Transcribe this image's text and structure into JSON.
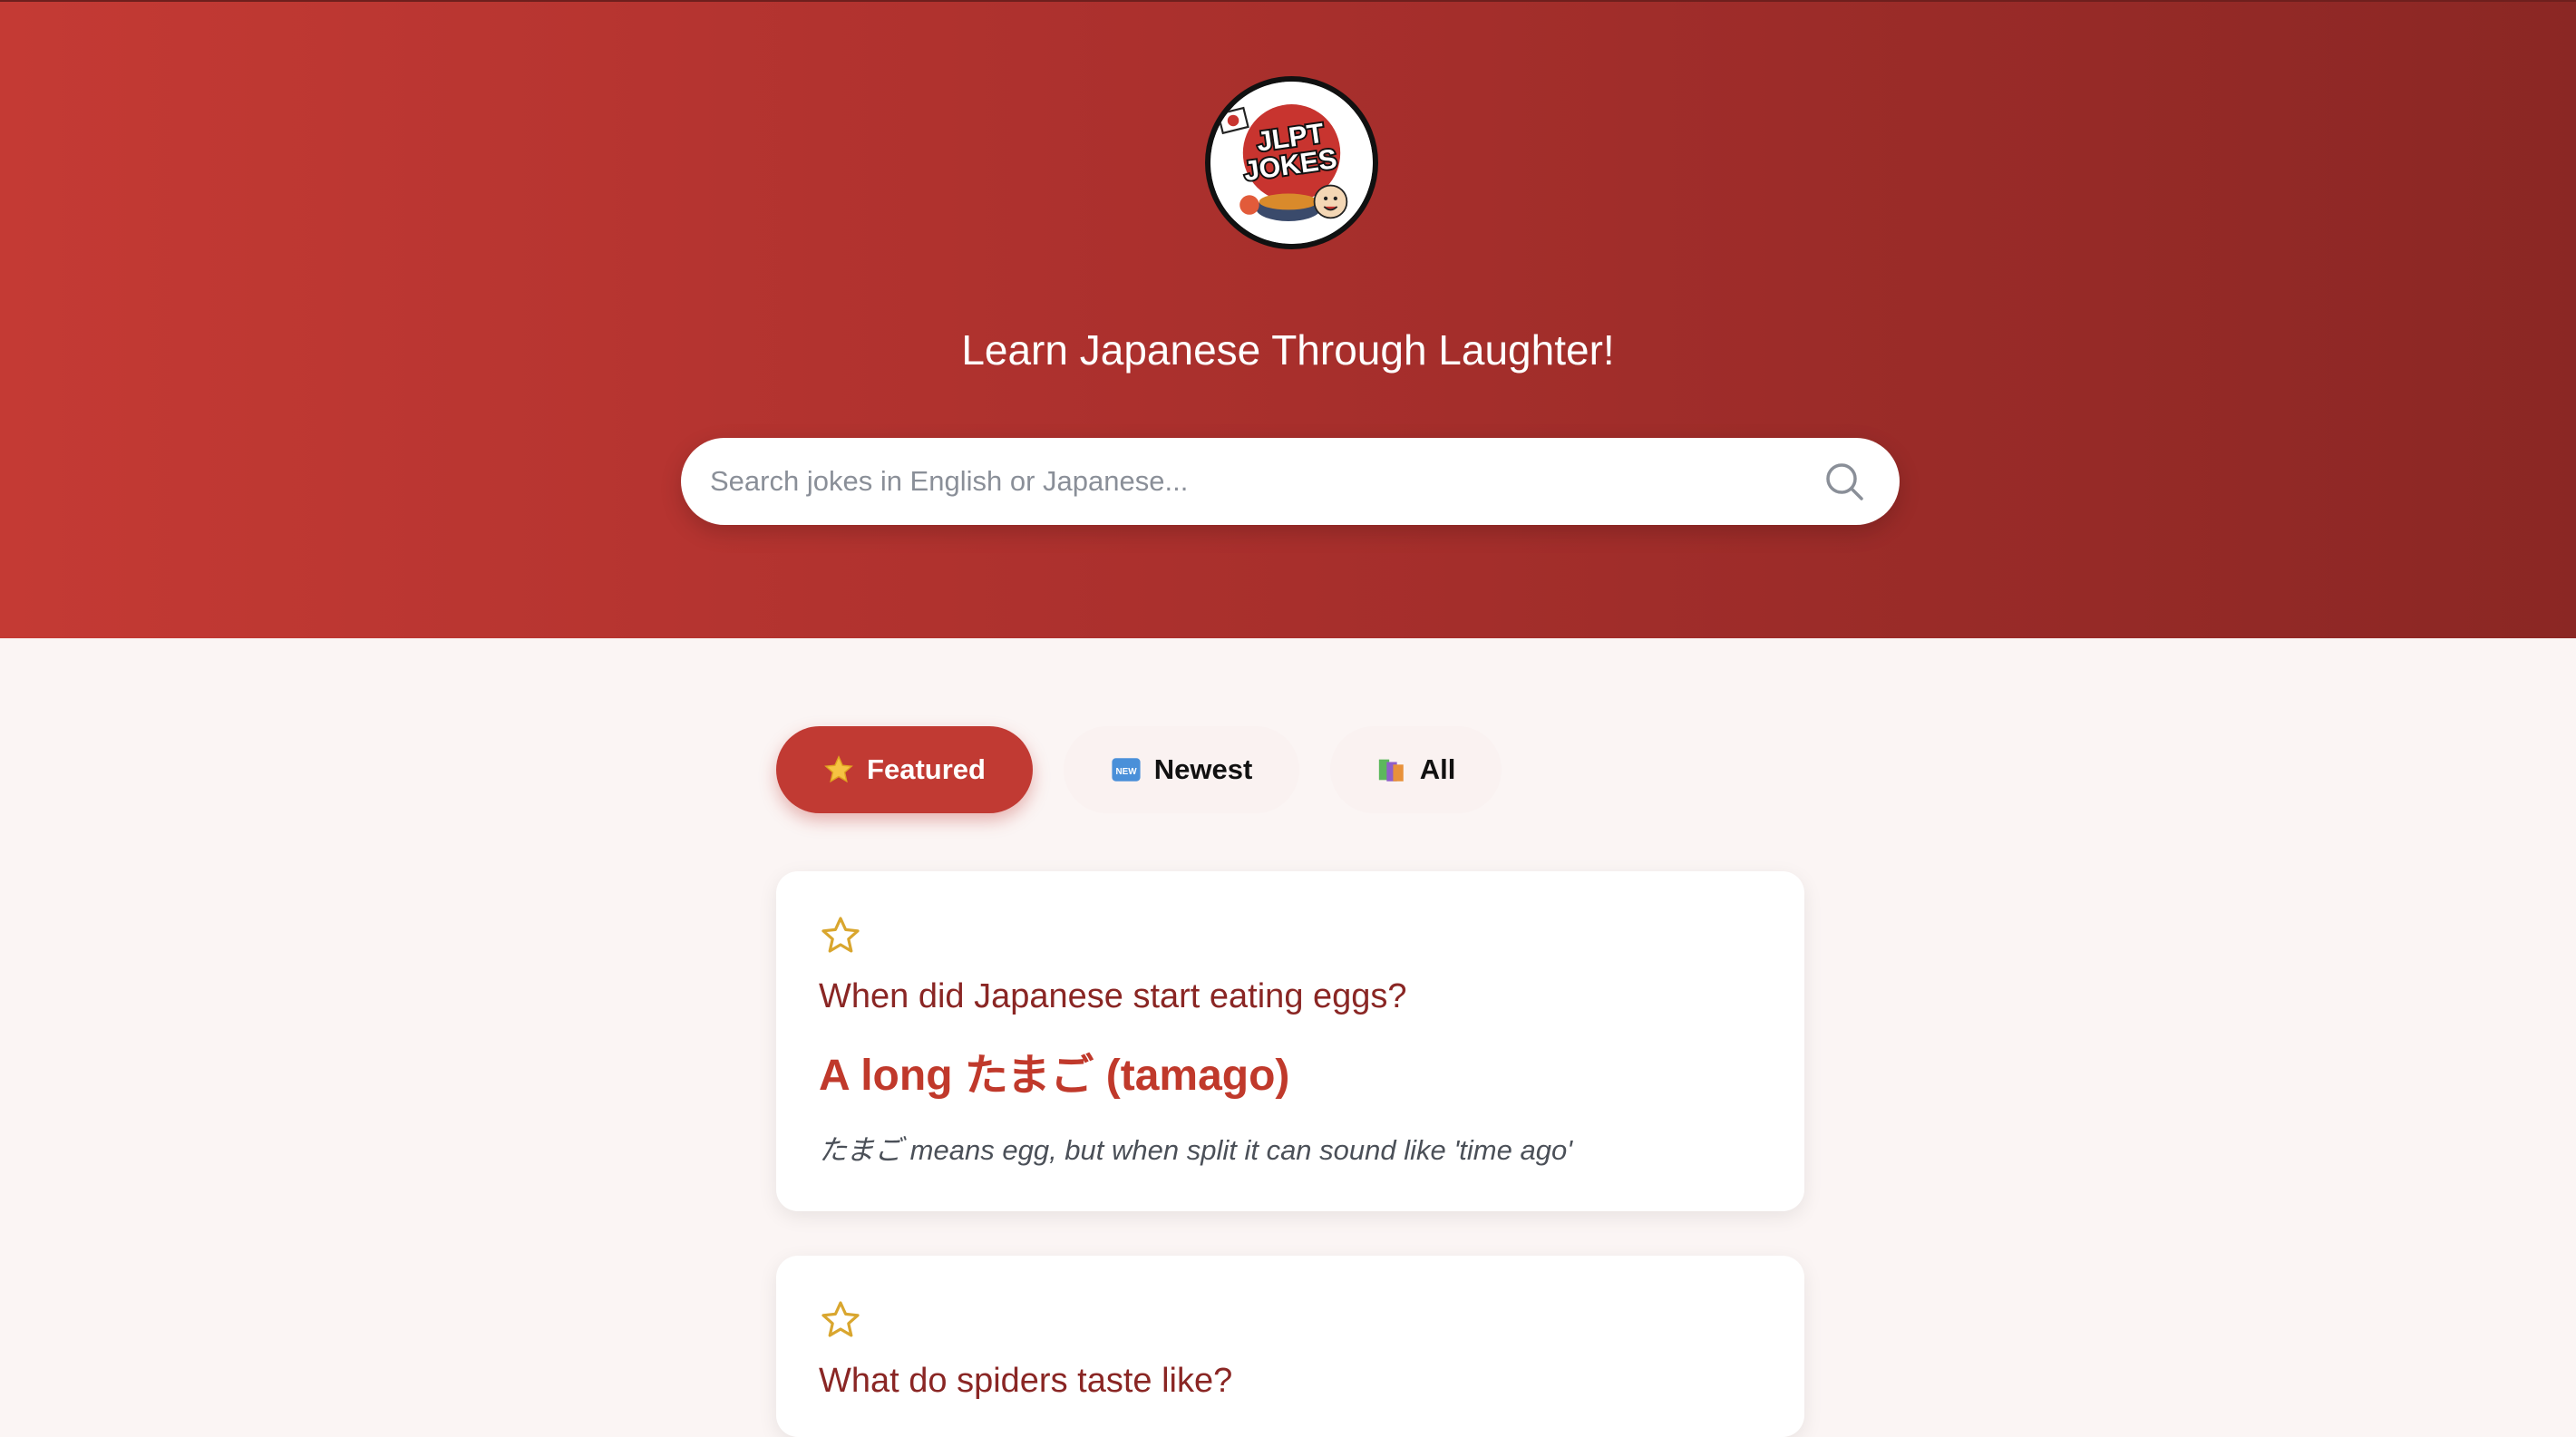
{
  "header": {
    "logo_text_line1": "JLPT",
    "logo_text_line2": "JOKES",
    "tagline": "Learn Japanese Through Laughter!"
  },
  "search": {
    "placeholder": "Search jokes in English or Japanese...",
    "value": "",
    "icon": "search-icon"
  },
  "tabs": [
    {
      "label": "Featured",
      "icon": "star-emoji",
      "active": true
    },
    {
      "label": "Newest",
      "icon": "new-badge-emoji",
      "active": false
    },
    {
      "label": "All",
      "icon": "books-emoji",
      "active": false
    }
  ],
  "jokes": [
    {
      "question": "When did Japanese start eating eggs?",
      "answer": "A long たまご (tamago)",
      "explanation": "たまご means egg, but when split it can sound like 'time ago'",
      "favorite_icon": "star-outline-icon"
    },
    {
      "question": "What do spiders taste like?",
      "answer": "",
      "explanation": "",
      "favorite_icon": "star-outline-icon"
    }
  ],
  "colors": {
    "brand_red": "#c13a33",
    "dark_red": "#8a2624",
    "star_gold": "#d9a62e",
    "page_bg": "#fbf5f4"
  }
}
